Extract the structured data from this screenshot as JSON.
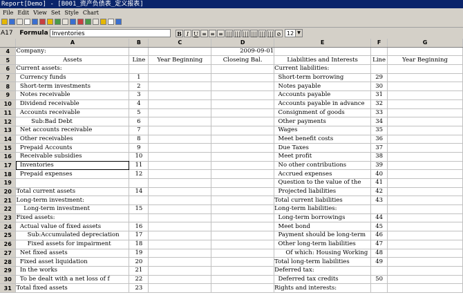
{
  "window": {
    "title": "Report[Demo] - [B001_资产负债表_定义报表]"
  },
  "menu": [
    "File",
    "Edit",
    "View",
    "Set",
    "Style",
    "Chart"
  ],
  "formula_bar": {
    "cell_ref": "A17",
    "label": "Formula",
    "value": "Inventories",
    "font_size": "12"
  },
  "format_buttons": [
    "B",
    "I",
    "U",
    "≡",
    "≡",
    "≡",
    "|||",
    "|||",
    "|||",
    "|||",
    "|||",
    "|||",
    "⊘"
  ],
  "columns": [
    "",
    "A",
    "B",
    "C",
    "D",
    "E",
    "F",
    "G"
  ],
  "rows": [
    {
      "n": "4",
      "a": "Company:",
      "b": "",
      "c": "",
      "d": "2009-09-01",
      "e": "",
      "f": "",
      "g": ""
    },
    {
      "n": "5",
      "a": "Assets",
      "b": "Line",
      "c": "Year Beginning",
      "d": "Closeing Bal.",
      "e": "Liabilities and Interests",
      "f": "Line",
      "g": "Year Beginning"
    },
    {
      "n": "6",
      "a": "Current assets:",
      "b": "",
      "c": "",
      "d": "",
      "e": "Current liabilities:",
      "f": "",
      "g": ""
    },
    {
      "n": "7",
      "a": "  Currency funds",
      "b": "1",
      "c": "",
      "d": "",
      "e": "  Short-term borrowing",
      "f": "29",
      "g": ""
    },
    {
      "n": "8",
      "a": "  Short-term investments",
      "b": "2",
      "c": "",
      "d": "",
      "e": "  Notes payable",
      "f": "30",
      "g": ""
    },
    {
      "n": "9",
      "a": "  Notes receivable",
      "b": "3",
      "c": "",
      "d": "",
      "e": "  Accounts payable",
      "f": "31",
      "g": ""
    },
    {
      "n": "10",
      "a": "  Dividend receivable",
      "b": "4",
      "c": "",
      "d": "",
      "e": "  Accounts payable in advance",
      "f": "32",
      "g": ""
    },
    {
      "n": "11",
      "a": "  Accounts receivable",
      "b": "5",
      "c": "",
      "d": "",
      "e": "  Consignment of goods",
      "f": "33",
      "g": ""
    },
    {
      "n": "12",
      "a": "        Sub:Bad Debt",
      "b": "6",
      "c": "",
      "d": "",
      "e": "  Other payments",
      "f": "34",
      "g": ""
    },
    {
      "n": "13",
      "a": "  Net accounts receivable",
      "b": "7",
      "c": "",
      "d": "",
      "e": "  Wages",
      "f": "35",
      "g": ""
    },
    {
      "n": "14",
      "a": "  Other receivables",
      "b": "8",
      "c": "",
      "d": "",
      "e": "  Meet benefit costs",
      "f": "36",
      "g": ""
    },
    {
      "n": "15",
      "a": "  Prepaid Accounts",
      "b": "9",
      "c": "",
      "d": "",
      "e": "  Due Taxes",
      "f": "37",
      "g": ""
    },
    {
      "n": "16",
      "a": "  Receivable subsidies",
      "b": "10",
      "c": "",
      "d": "",
      "e": "  Meet profit",
      "f": "38",
      "g": ""
    },
    {
      "n": "17",
      "a": "  Inventories",
      "b": "11",
      "c": "",
      "d": "",
      "e": "  No other contributions",
      "f": "39",
      "g": ""
    },
    {
      "n": "18",
      "a": "  Prepaid expenses",
      "b": "12",
      "c": "",
      "d": "",
      "e": "  Accrued expenses",
      "f": "40",
      "g": ""
    },
    {
      "n": "19",
      "a": "",
      "b": "",
      "c": "",
      "d": "",
      "e": "  Question to the value of the",
      "f": "41",
      "g": ""
    },
    {
      "n": "20",
      "a": "Total current assets",
      "b": "14",
      "c": "",
      "d": "",
      "e": "  Projected liabilities",
      "f": "42",
      "g": ""
    },
    {
      "n": "21",
      "a": "Long-term investment:",
      "b": "",
      "c": "",
      "d": "",
      "e": "Total current liabilities",
      "f": "43",
      "g": ""
    },
    {
      "n": "22",
      "a": "    Long-term investment",
      "b": "15",
      "c": "",
      "d": "",
      "e": "Long-term liabilities:",
      "f": "",
      "g": ""
    },
    {
      "n": "23",
      "a": "Fixed assets:",
      "b": "",
      "c": "",
      "d": "",
      "e": "  Long-term borrowings",
      "f": "44",
      "g": ""
    },
    {
      "n": "24",
      "a": "  Actual value of fixed assets",
      "b": "16",
      "c": "",
      "d": "",
      "e": "  Meet bond",
      "f": "45",
      "g": ""
    },
    {
      "n": "25",
      "a": "      Sub:Accumulated depreciation",
      "b": "17",
      "c": "",
      "d": "",
      "e": "  Payment should be long-term",
      "f": "46",
      "g": ""
    },
    {
      "n": "26",
      "a": "      Fixed assets for impairment",
      "b": "18",
      "c": "",
      "d": "",
      "e": "  Other long-term liabilities",
      "f": "47",
      "g": ""
    },
    {
      "n": "27",
      "a": "  Net fixed assets",
      "b": "19",
      "c": "",
      "d": "",
      "e": "      Of which: Housing Working",
      "f": "48",
      "g": ""
    },
    {
      "n": "28",
      "a": "  Fixed asset liquidation",
      "b": "20",
      "c": "",
      "d": "",
      "e": "Total long-term liabilities",
      "f": "49",
      "g": ""
    },
    {
      "n": "29",
      "a": "  In the works",
      "b": "21",
      "c": "",
      "d": "",
      "e": "Deferred tax:",
      "f": "",
      "g": ""
    },
    {
      "n": "30",
      "a": "  To be dealt with a net loss of f",
      "b": "22",
      "c": "",
      "d": "",
      "e": "  Deferred tax credits",
      "f": "50",
      "g": ""
    },
    {
      "n": "31",
      "a": "Total fixed assets",
      "b": "23",
      "c": "",
      "d": "",
      "e": "Rights and interests:",
      "f": "",
      "g": ""
    }
  ]
}
